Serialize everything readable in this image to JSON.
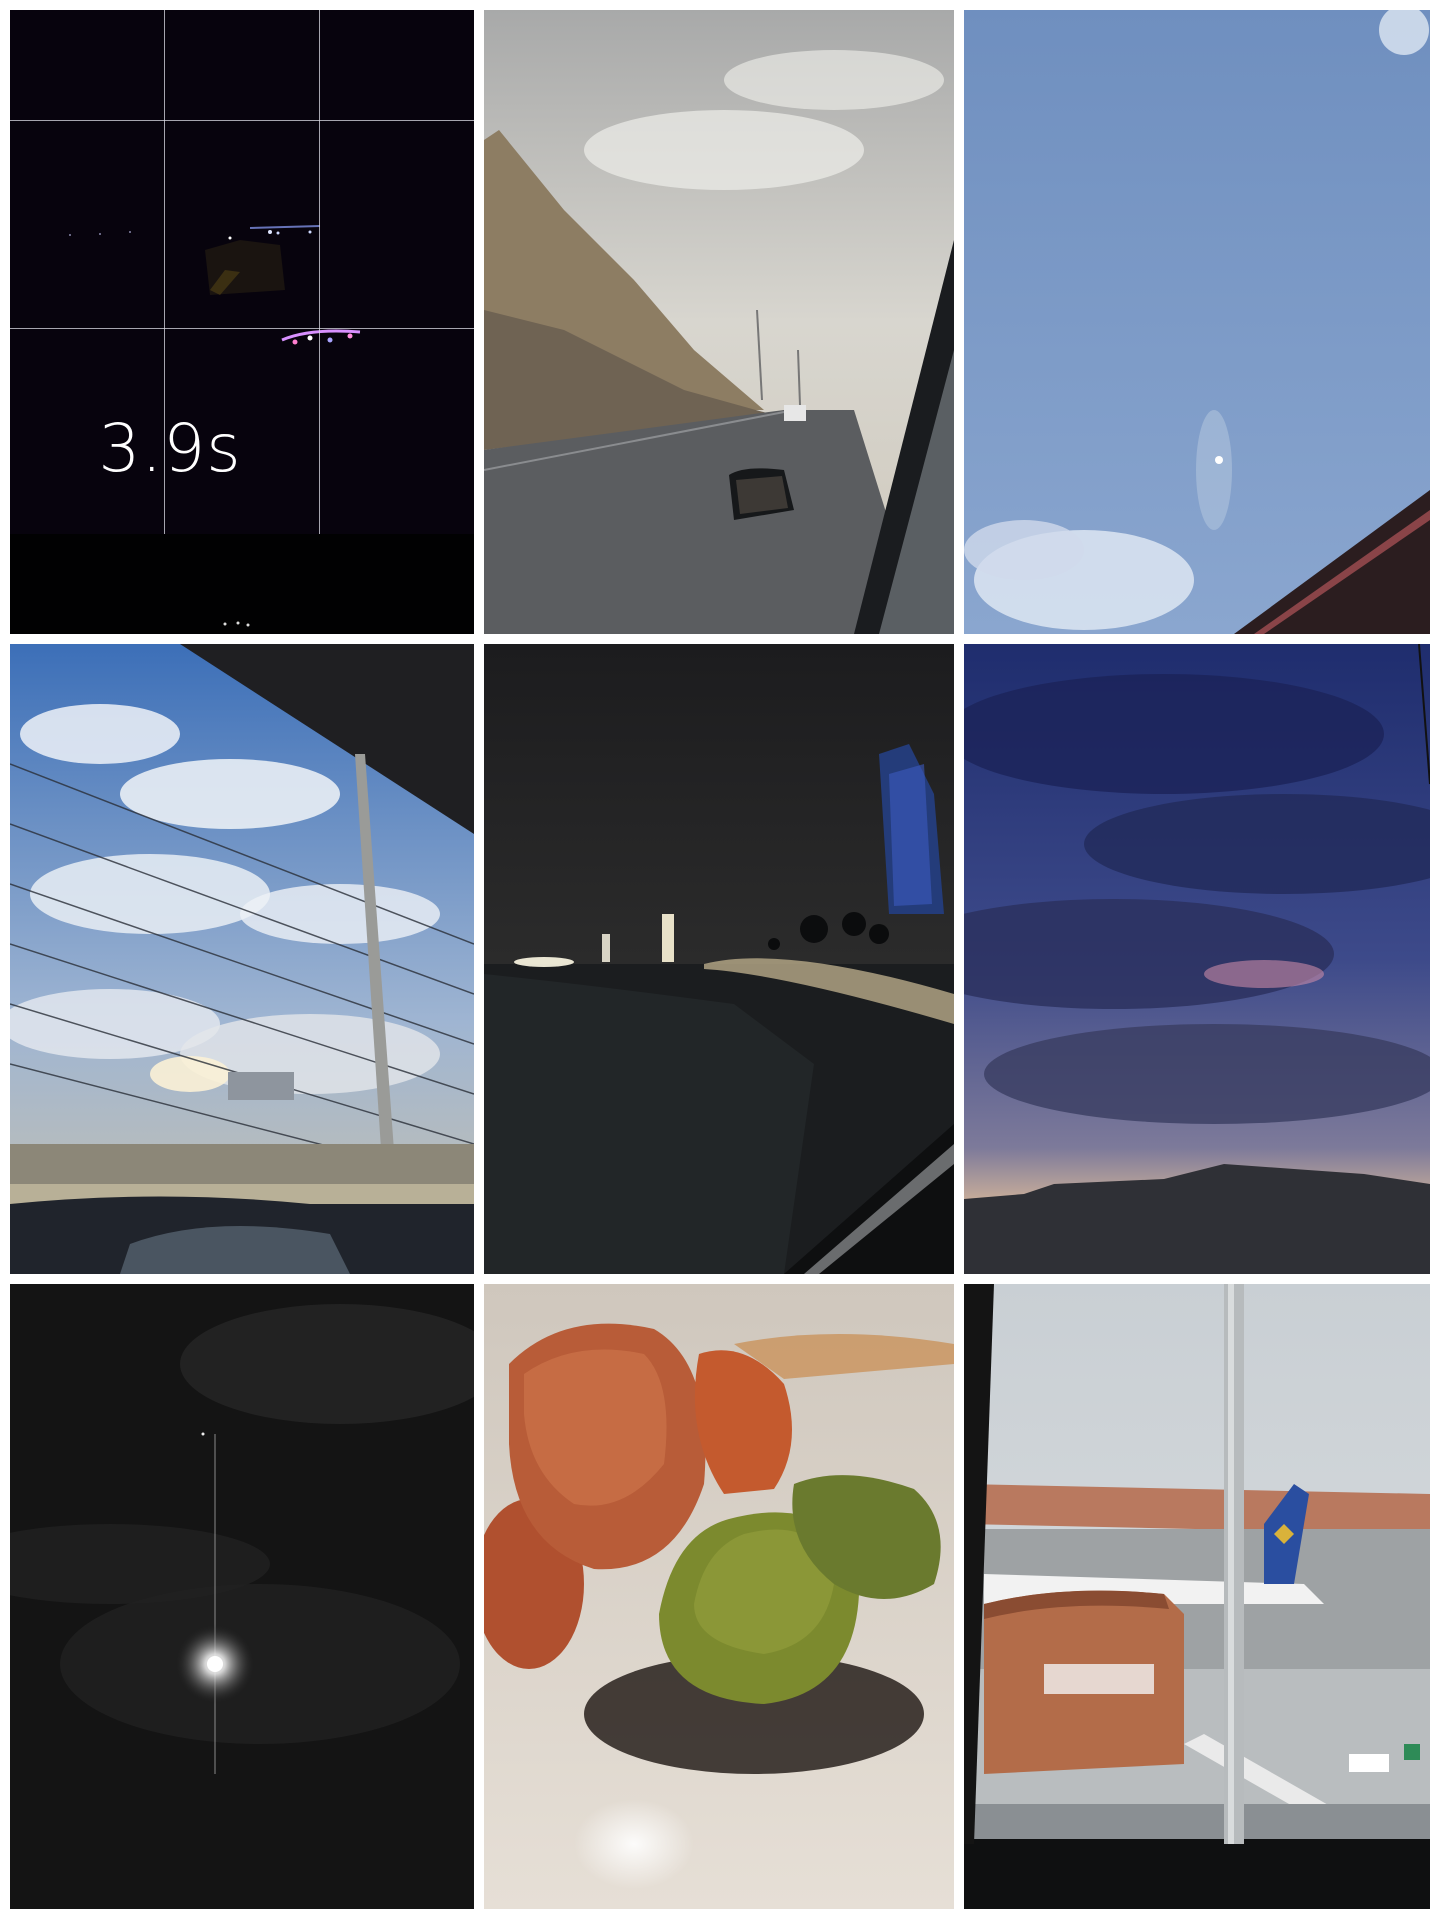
{
  "collage": {
    "tiles": [
      {
        "id": "night-camera-preview",
        "overlay_text": "3.9s"
      },
      {
        "id": "mountain-road-from-car"
      },
      {
        "id": "blue-sky-with-moon"
      },
      {
        "id": "cloudy-sky-through-car-window"
      },
      {
        "id": "night-corniche-skyline"
      },
      {
        "id": "dusk-purple-clouds"
      },
      {
        "id": "moon-in-night-sky"
      },
      {
        "id": "colored-stones-closeup"
      },
      {
        "id": "airport-terminal-with-plane"
      }
    ]
  }
}
